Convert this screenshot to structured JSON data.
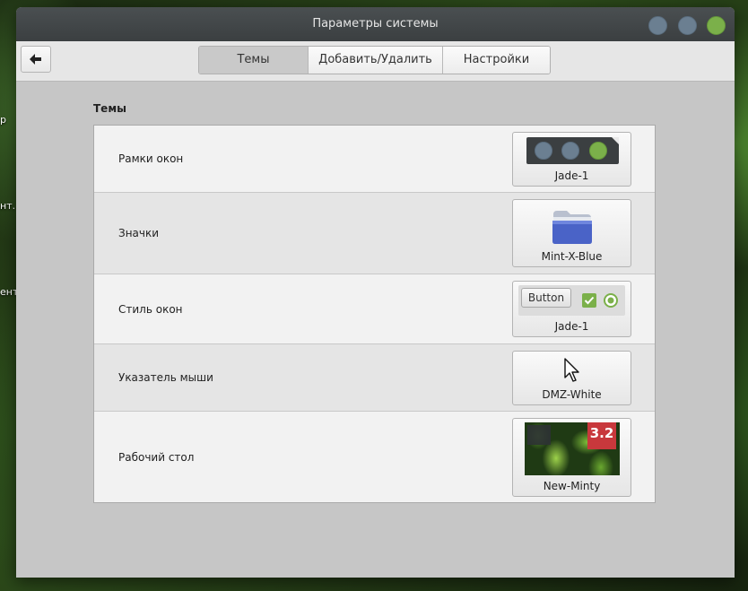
{
  "desktop": {
    "labels": [
      "р",
      "нт.",
      "ент"
    ]
  },
  "window": {
    "title": "Параметры системы"
  },
  "tabs": [
    {
      "label": "Темы",
      "active": true
    },
    {
      "label": "Добавить/Удалить",
      "active": false
    },
    {
      "label": "Настройки",
      "active": false
    }
  ],
  "section": {
    "title": "Темы"
  },
  "rows": [
    {
      "label": "Рамки окон",
      "value": "Jade-1"
    },
    {
      "label": "Значки",
      "value": "Mint-X-Blue"
    },
    {
      "label": "Стиль окон",
      "value": "Jade-1",
      "preview_button": "Button"
    },
    {
      "label": "Указатель мыши",
      "value": "DMZ-White"
    },
    {
      "label": "Рабочий стол",
      "value": "New-Minty",
      "badge": "3.2"
    }
  ],
  "colors": {
    "accent_green": "#7bb04a",
    "titlebar": "#3b3f41",
    "folder_blue": "#4a63c7",
    "badge_red": "#c8383c"
  }
}
